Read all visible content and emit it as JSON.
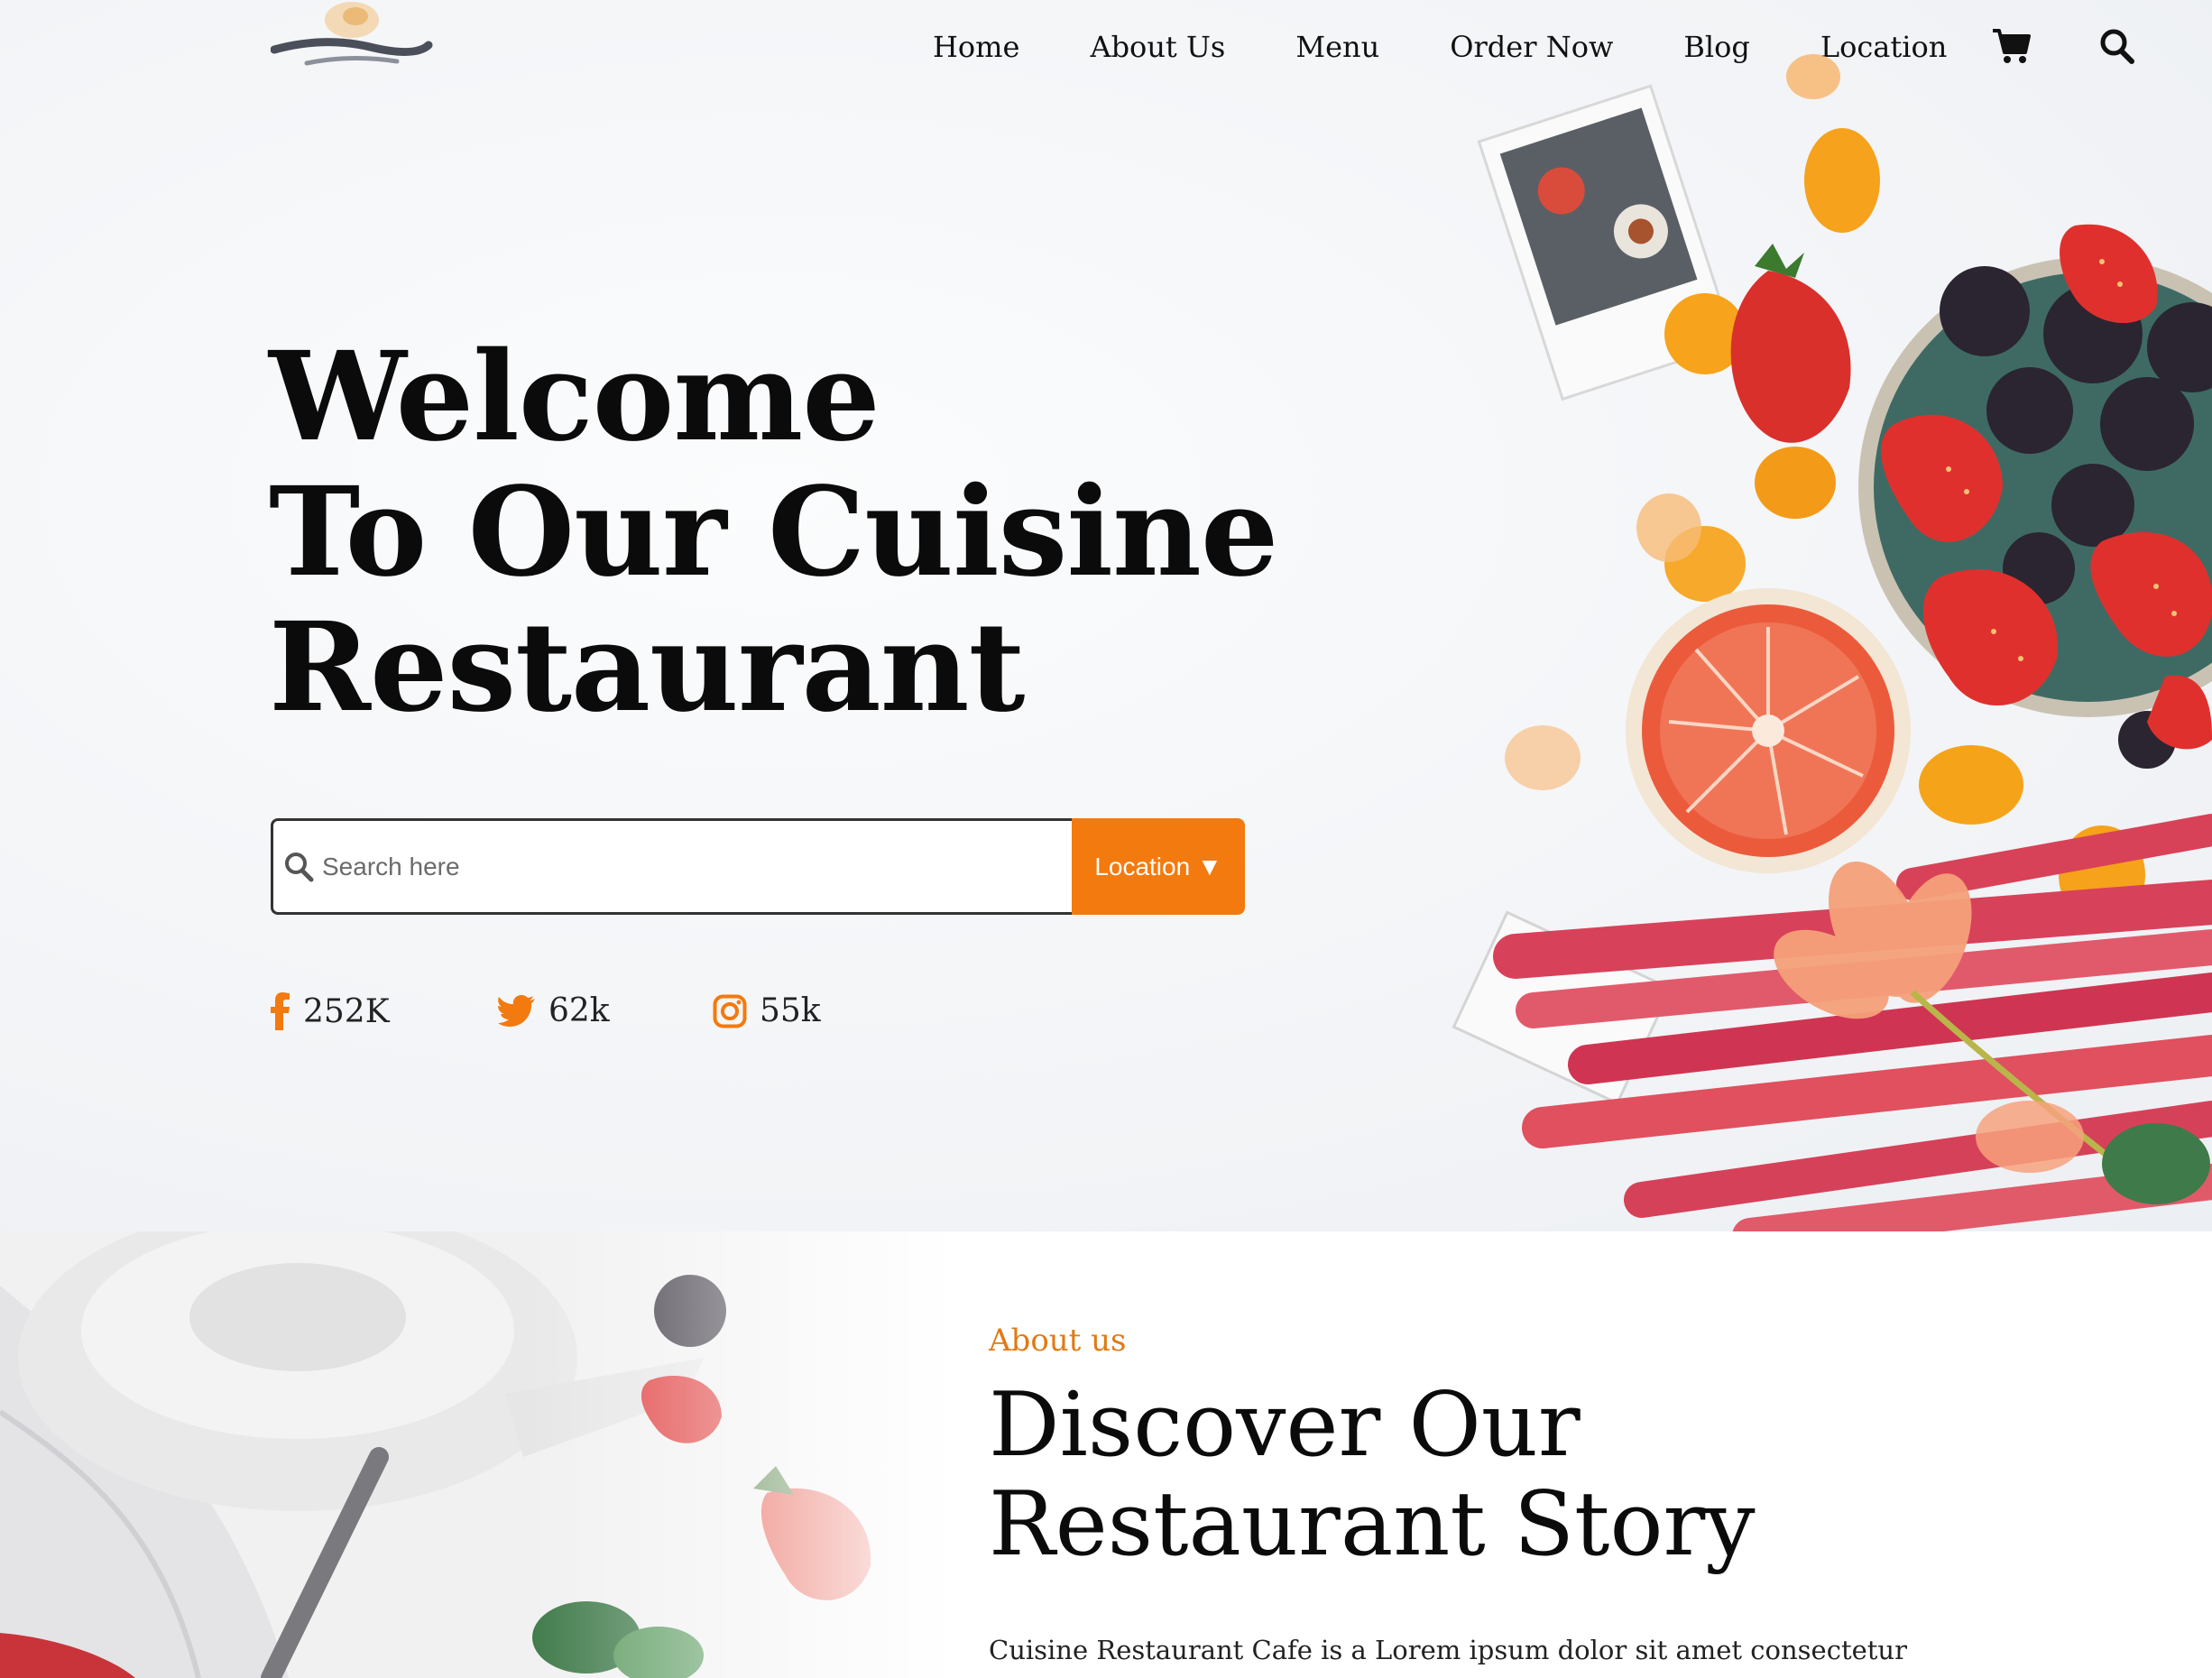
{
  "header": {
    "logo_icon": "restaurant-logo",
    "nav": [
      {
        "label": "Home"
      },
      {
        "label": "About Us"
      },
      {
        "label": "Menu"
      },
      {
        "label": "Order Now"
      },
      {
        "label": "Blog"
      },
      {
        "label": "Location"
      }
    ],
    "cart_icon": "cart-icon",
    "search_icon": "search-icon"
  },
  "hero": {
    "title_lines": [
      "Welcome",
      "To Our Cuisine",
      "Restaurant"
    ],
    "search": {
      "placeholder": "Search here",
      "button_label": "Location ▼"
    },
    "social": [
      {
        "icon": "facebook-icon",
        "count": "252K"
      },
      {
        "icon": "twitter-icon",
        "count": "62k"
      },
      {
        "icon": "instagram-icon",
        "count": "55k"
      }
    ]
  },
  "about": {
    "kicker": "About us",
    "title_lines": [
      "Discover Our",
      "Restaurant Story"
    ],
    "text": "Cuisine Restaurant Cafe is a Lorem ipsum dolor sit amet consectetur"
  },
  "colors": {
    "accent": "#f37a0f",
    "text": "#111111",
    "background": "#f3f5f8"
  }
}
